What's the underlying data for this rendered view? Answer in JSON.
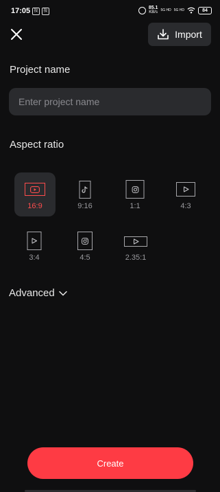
{
  "status_bar": {
    "time": "17:05",
    "notification_icons": [
      "投",
      "投"
    ],
    "net_speed_value": "85.1",
    "net_speed_unit": "KB/s",
    "sim1": "5G HD",
    "sim2": "5G HD",
    "battery": "84"
  },
  "header": {
    "close_icon": "close-icon",
    "import_label": "Import",
    "import_icon": "download-icon"
  },
  "project": {
    "label": "Project name",
    "placeholder": "Enter project name",
    "value": ""
  },
  "aspect": {
    "label": "Aspect ratio",
    "selected": "16:9",
    "options": [
      {
        "label": "16:9",
        "icon": "youtube-icon"
      },
      {
        "label": "9:16",
        "icon": "tiktok-icon"
      },
      {
        "label": "1:1",
        "icon": "instagram-icon"
      },
      {
        "label": "4:3",
        "icon": "play-icon"
      },
      {
        "label": "3:4",
        "icon": "play-icon"
      },
      {
        "label": "4:5",
        "icon": "instagram-icon"
      },
      {
        "label": "2.35:1",
        "icon": "play-icon"
      }
    ]
  },
  "advanced": {
    "label": "Advanced",
    "icon": "chevron-down-icon"
  },
  "create": {
    "label": "Create"
  },
  "colors": {
    "background": "#0f0f10",
    "surface": "#2a2b2e",
    "accent": "#fe3b44",
    "selected_text": "#ff4d4d"
  }
}
